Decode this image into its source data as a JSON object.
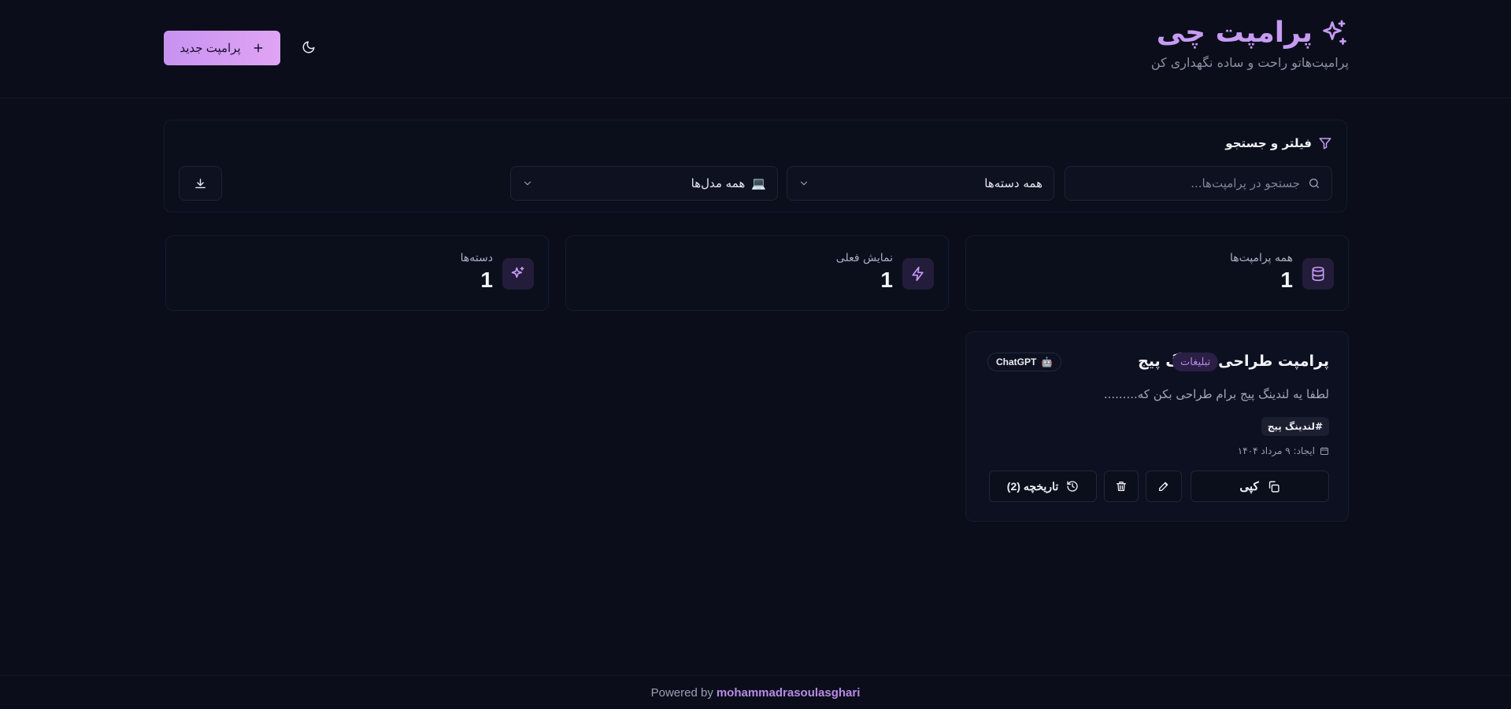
{
  "colors": {
    "background": "#0b0e1a",
    "accent": "#c79bf4",
    "accent_button_from": "#c792f0",
    "accent_button_to": "#e0a4f5",
    "category_badge_bg": "#2a1f44",
    "category_badge_text": "#b88ae8"
  },
  "header": {
    "title": "پرامپت چی",
    "subtitle": "پرامپت‌هاتو راحت و ساده نگهداری کن",
    "brand_icon": "sparkles-icon",
    "new_prompt_label": "پرامپت جدید",
    "new_prompt_icon": "plus-icon",
    "theme_toggle_icon": "moon-icon"
  },
  "filters": {
    "title": "فیلتر و جستجو",
    "title_icon": "filter-icon",
    "search_placeholder": "جستجو در پرامپت‌ها...",
    "category_selected": "همه دسته‌ها",
    "model_selected": "همه مدل‌ها",
    "model_emoji": "💻",
    "download_icon": "download-icon"
  },
  "stats": [
    {
      "label": "همه پرامپت‌ها",
      "value": "1",
      "icon": "database-icon"
    },
    {
      "label": "نمایش فعلی",
      "value": "1",
      "icon": "zap-icon"
    },
    {
      "label": "دسته‌ها",
      "value": "1",
      "icon": "sparkles-icon"
    }
  ],
  "prompt_card": {
    "title": "پرامپت طراحی لندینگ پیج",
    "category": "تبلیغات",
    "model": "ChatGPT",
    "model_emoji": "🤖",
    "description": "لطفا یه لندینگ پیج برام طراحی بکن که.........",
    "tag": "#لندینگ پیج",
    "created": "ایجاد: ۹ مرداد ۱۴۰۴",
    "copy_label": "کپی",
    "history_label": "تاریخچه (2)"
  },
  "footer": {
    "powered_by": "Powered by",
    "author": "mohammadrasoulasghari"
  }
}
